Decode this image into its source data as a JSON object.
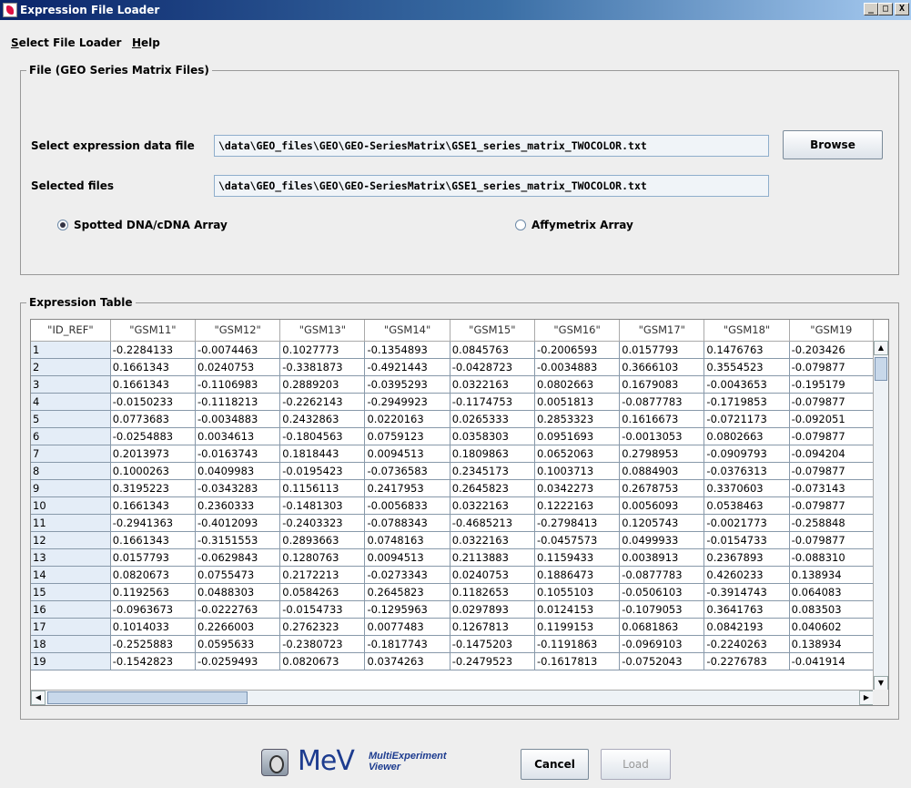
{
  "window": {
    "title": "Expression File Loader",
    "controls": [
      "_",
      "□",
      "X"
    ]
  },
  "menu": [
    {
      "mnemonic": "S",
      "rest": "elect File Loader"
    },
    {
      "mnemonic": "H",
      "rest": "elp"
    }
  ],
  "file_group": {
    "legend": "File   (GEO Series Matrix Files)",
    "select_label": "Select expression data file",
    "select_value": "\\data\\GEO_files\\GEO\\GEO-SeriesMatrix\\GSE1_series_matrix_TWOCOLOR.txt",
    "browse_label": "Browse",
    "selected_label": "Selected files",
    "selected_value": "\\data\\GEO_files\\GEO\\GEO-SeriesMatrix\\GSE1_series_matrix_TWOCOLOR.txt",
    "radio_spotted": "Spotted DNA/cDNA Array",
    "radio_affy": "Affymetrix Array",
    "selected_radio": "spotted"
  },
  "table_group": {
    "legend": "Expression Table",
    "headers": [
      "\"ID_REF\"",
      "\"GSM11\"",
      "\"GSM12\"",
      "\"GSM13\"",
      "\"GSM14\"",
      "\"GSM15\"",
      "\"GSM16\"",
      "\"GSM17\"",
      "\"GSM18\"",
      "\"GSM19"
    ],
    "rows": [
      [
        "1",
        "-0.2284133",
        "-0.0074463",
        "0.1027773",
        "-0.1354893",
        "0.0845763",
        "-0.2006593",
        "0.0157793",
        "0.1476763",
        "-0.203426"
      ],
      [
        "2",
        "0.1661343",
        "0.0240753",
        "-0.3381873",
        "-0.4921443",
        "-0.0428723",
        "-0.0034883",
        "0.3666103",
        "0.3554523",
        "-0.079877"
      ],
      [
        "3",
        "0.1661343",
        "-0.1106983",
        "0.2889203",
        "-0.0395293",
        "0.0322163",
        "0.0802663",
        "0.1679083",
        "-0.0043653",
        "-0.195179"
      ],
      [
        "4",
        "-0.0150233",
        "-0.1118213",
        "-0.2262143",
        "-0.2949923",
        "-0.1174753",
        "0.0051813",
        "-0.0877783",
        "-0.1719853",
        "-0.079877"
      ],
      [
        "5",
        "0.0773683",
        "-0.0034883",
        "0.2432863",
        "0.0220163",
        "0.0265333",
        "0.2853323",
        "0.1616673",
        "-0.0721173",
        "-0.092051"
      ],
      [
        "6",
        "-0.0254883",
        "0.0034613",
        "-0.1804563",
        "0.0759123",
        "0.0358303",
        "0.0951693",
        "-0.0013053",
        "0.0802663",
        "-0.079877"
      ],
      [
        "7",
        "0.2013973",
        "-0.0163743",
        "0.1818443",
        "0.0094513",
        "0.1809863",
        "0.0652063",
        "0.2798953",
        "-0.0909793",
        "-0.094204"
      ],
      [
        "8",
        "0.1000263",
        "0.0409983",
        "-0.0195423",
        "-0.0736583",
        "0.2345173",
        "0.1003713",
        "0.0884903",
        "-0.0376313",
        "-0.079877"
      ],
      [
        "9",
        "0.3195223",
        "-0.0343283",
        "0.1156113",
        "0.2417953",
        "0.2645823",
        "0.0342273",
        "0.2678753",
        "0.3370603",
        "-0.073143"
      ],
      [
        "10",
        "0.1661343",
        "0.2360333",
        "-0.1481303",
        "-0.0056833",
        "0.0322163",
        "0.1222163",
        "0.0056093",
        "0.0538463",
        "-0.079877"
      ],
      [
        "11",
        "-0.2941363",
        "-0.4012093",
        "-0.2403323",
        "-0.0788343",
        "-0.4685213",
        "-0.2798413",
        "0.1205743",
        "-0.0021773",
        "-0.258848"
      ],
      [
        "12",
        "0.1661343",
        "-0.3151553",
        "0.2893663",
        "0.0748163",
        "0.0322163",
        "-0.0457573",
        "0.0499933",
        "-0.0154733",
        "-0.079877"
      ],
      [
        "13",
        "0.0157793",
        "-0.0629843",
        "0.1280763",
        "0.0094513",
        "0.2113883",
        "0.1159433",
        "0.0038913",
        "0.2367893",
        "-0.088310"
      ],
      [
        "14",
        "0.0820673",
        "0.0755473",
        "0.2172213",
        "-0.0273343",
        "0.0240753",
        "0.1886473",
        "-0.0877783",
        "0.4260233",
        "0.138934"
      ],
      [
        "15",
        "0.1192563",
        "0.0488303",
        "0.0584263",
        "0.2645823",
        "0.1182653",
        "0.1055103",
        "-0.0506103",
        "-0.3914743",
        "0.064083"
      ],
      [
        "16",
        "-0.0963673",
        "-0.0222763",
        "-0.0154733",
        "-0.1295963",
        "0.0297893",
        "0.0124153",
        "-0.1079053",
        "0.3641763",
        "0.083503"
      ],
      [
        "17",
        "0.1014033",
        "0.2266003",
        "0.2762323",
        "0.0077483",
        "0.1267813",
        "0.1199153",
        "0.0681863",
        "0.0842193",
        "0.040602"
      ],
      [
        "18",
        "-0.2525883",
        "0.0595633",
        "-0.2380723",
        "-0.1817743",
        "-0.1475203",
        "-0.1191863",
        "-0.0969103",
        "-0.2240263",
        "0.138934"
      ],
      [
        "19",
        "-0.1542823",
        "-0.0259493",
        "0.0820673",
        "0.0374263",
        "-0.2479523",
        "-0.1617813",
        "-0.0752043",
        "-0.2276783",
        "-0.041914"
      ]
    ]
  },
  "bottom": {
    "logo_text": "MeV",
    "logo_sub_1": "MultiExperiment",
    "logo_sub_2": "Viewer",
    "cancel_label": "Cancel",
    "load_label": "Load"
  }
}
